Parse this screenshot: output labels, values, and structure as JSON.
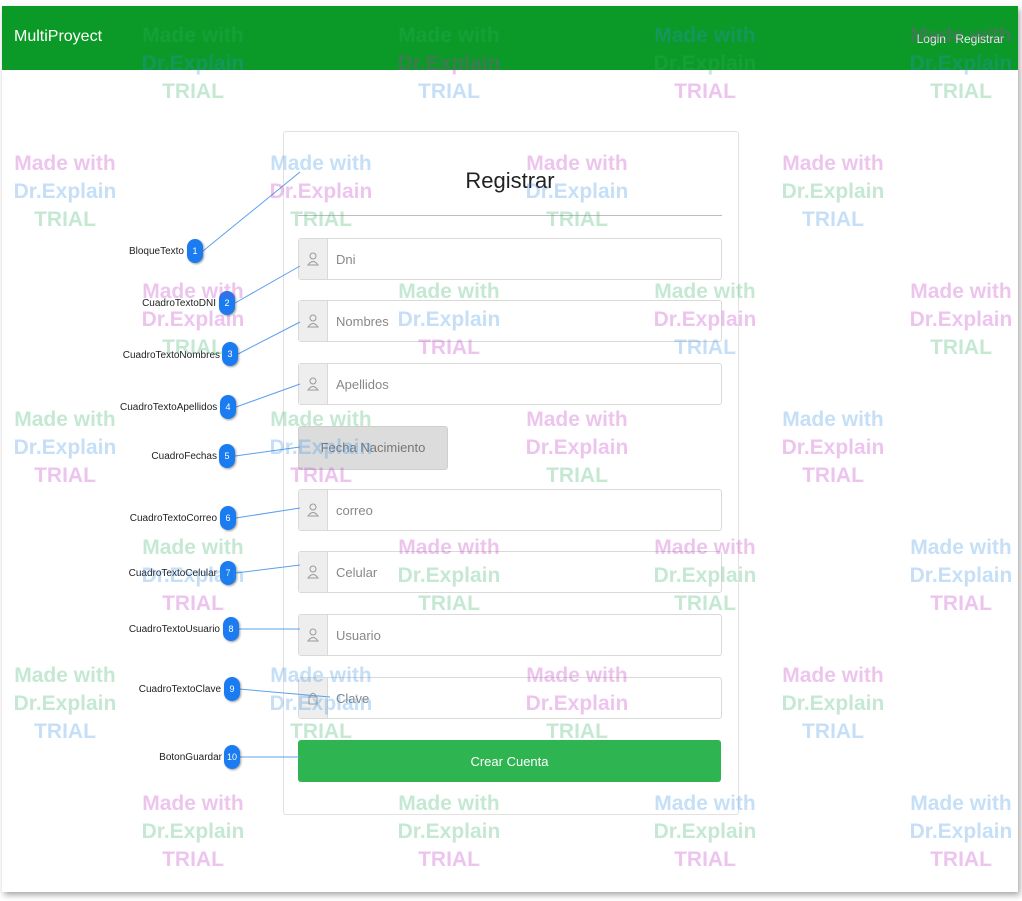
{
  "navbar": {
    "brand": "MultiProyect",
    "links": [
      "Login",
      "Registrar"
    ],
    "color": "#0b9a27"
  },
  "form": {
    "title": "Registrar",
    "fields": [
      {
        "placeholder": "Dni",
        "icon": "user-icon"
      },
      {
        "placeholder": "Nombres",
        "icon": "user-icon"
      },
      {
        "placeholder": "Apellidos",
        "icon": "user-icon"
      },
      {
        "placeholder": "correo",
        "icon": "user-icon"
      },
      {
        "placeholder": "Celular",
        "icon": "user-icon"
      },
      {
        "placeholder": "Usuario",
        "icon": "user-icon"
      },
      {
        "placeholder": "Clave",
        "icon": "user-icon"
      }
    ],
    "date_button": "Fecha Nacimiento",
    "submit_label": "Crear Cuenta",
    "submit_color": "#2eb551"
  },
  "callouts": [
    {
      "num": "1",
      "label": "BloqueTexto"
    },
    {
      "num": "2",
      "label": "CuadroTextoDNI"
    },
    {
      "num": "3",
      "label": "CuadroTextoNombres"
    },
    {
      "num": "4",
      "label": "CuadroTextoApellidos"
    },
    {
      "num": "5",
      "label": "CuadroFechas"
    },
    {
      "num": "6",
      "label": "CuadroTextoCorreo"
    },
    {
      "num": "7",
      "label": "CuadroTextoCelular"
    },
    {
      "num": "8",
      "label": "CuadroTextoUsuario"
    },
    {
      "num": "9",
      "label": "CuadroTextoClave"
    },
    {
      "num": "10",
      "label": "BotonGuardar"
    }
  ],
  "watermark": {
    "line1": "Made with",
    "line2": "Dr.Explain",
    "line3": "TRIAL"
  }
}
